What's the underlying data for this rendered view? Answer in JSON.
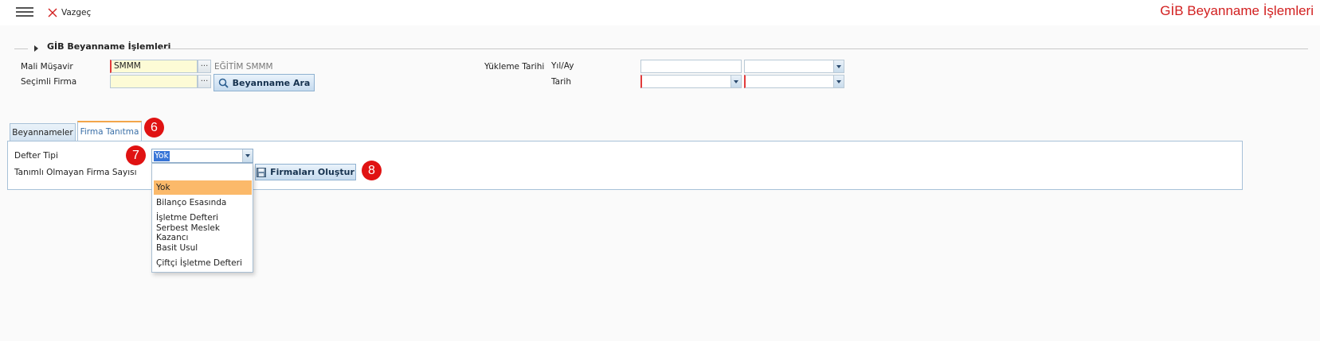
{
  "header": {
    "cancel_label": "Vazgeç",
    "app_title": "GİB Beyanname İşlemleri"
  },
  "section": {
    "title": "GİB Beyanname İşlemleri"
  },
  "form": {
    "mali_musavir_label": "Mali Müşavir",
    "mali_musavir_value": "SMMM",
    "mali_musavir_desc": "EĞİTİM SMMM",
    "secimli_firma_label": "Seçimli Firma",
    "secimli_firma_value": "",
    "search_button": "Beyanname Ara",
    "yukleme_tarihi_label": "Yükleme Tarihi",
    "yil_ay_label": "Yıl/Ay",
    "tarih_label": "Tarih",
    "ellipsis": "···"
  },
  "tabs": [
    {
      "label": "Beyannameler",
      "active": false
    },
    {
      "label": "Firma Tanıtma",
      "active": true
    }
  ],
  "panel": {
    "defter_tipi_label": "Defter Tipi",
    "defter_tipi_value": "Yok",
    "tanimli_label": "Tanımlı Olmayan Firma Sayısı",
    "create_button": "Firmaları Oluştur"
  },
  "dropdown": {
    "options": [
      "Yok",
      "Bilanço Esasında",
      "İşletme Defteri",
      "Serbest Meslek Kazancı",
      "Basit Usul",
      "Çiftçi İşletme Defteri"
    ],
    "selected": "Yok"
  },
  "badges": [
    "6",
    "7",
    "8"
  ],
  "colors": {
    "title_red": "#d21f1f",
    "badge_red": "#e01212",
    "selected_option": "#fbb96a",
    "active_tab_text": "#3a6fa7"
  },
  "icons": {
    "menu": "hamburger-menu-icon",
    "cancel": "close-x-icon",
    "search": "search-icon",
    "save": "save-disk-icon",
    "dropdown": "chevron-down-icon",
    "legend": "caret-right-icon"
  }
}
